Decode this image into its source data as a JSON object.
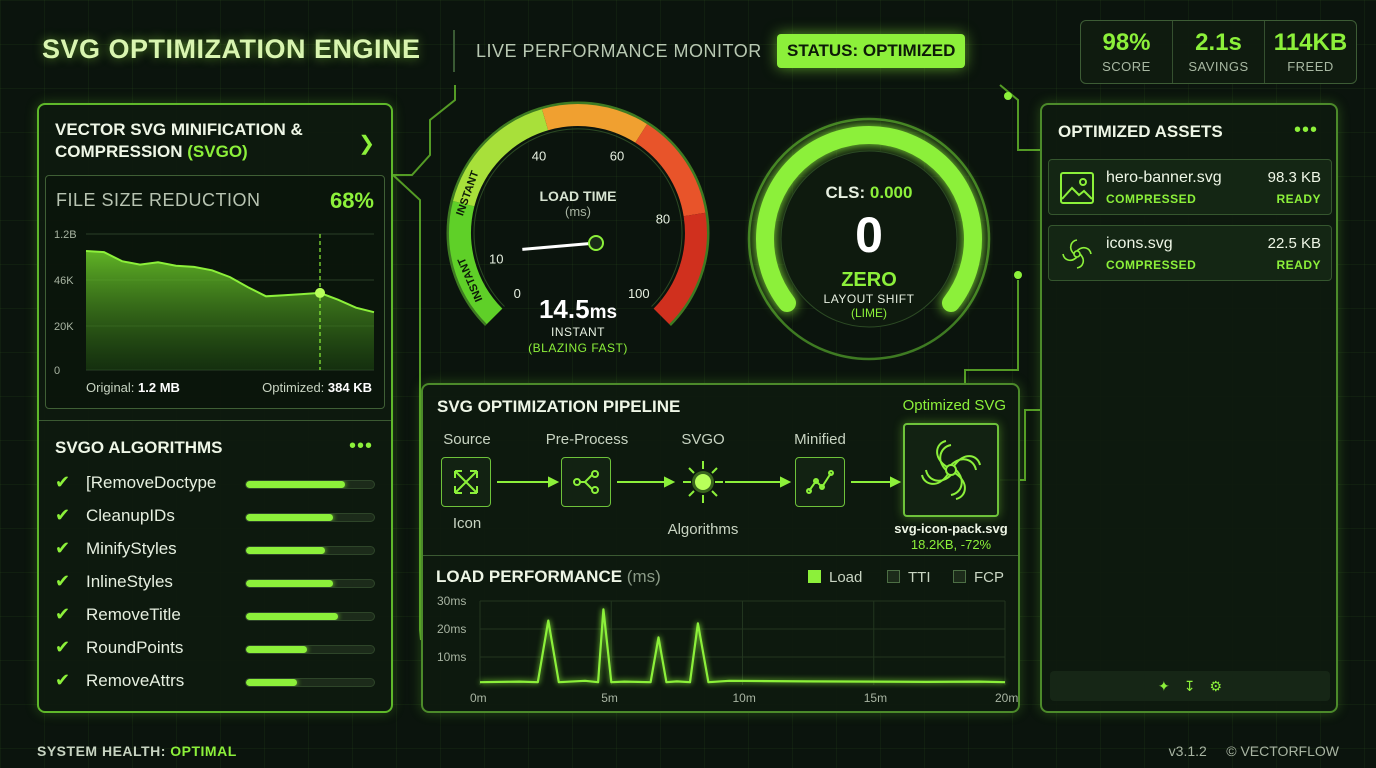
{
  "header": {
    "title": "SVG OPTIMIZATION ENGINE",
    "subtitle": "LIVE PERFORMANCE MONITOR",
    "status": "STATUS: OPTIMIZED",
    "stats": [
      {
        "value": "98%",
        "label": "SCORE"
      },
      {
        "value": "2.1s",
        "label": "SAVINGS"
      },
      {
        "value": "114KB",
        "label": "FREED"
      }
    ]
  },
  "left_panel": {
    "title_line1": "VECTOR SVG MINIFICATION &",
    "title_line2": "COMPRESSION",
    "title_accent": "(SVGO)",
    "file_size_label": "FILE SIZE REDUCTION",
    "file_size_pct": "68%",
    "original_label": "Original:",
    "original_value": "1.2 MB",
    "optimized_label": "Optimized:",
    "optimized_value": "384 KB",
    "algorithms_title": "SVGO ALGORITHMS",
    "algorithms": [
      {
        "name": "[RemoveDoctype",
        "level": 0.77
      },
      {
        "name": "CleanupIDs",
        "level": 0.68
      },
      {
        "name": "MinifyStyles",
        "level": 0.62
      },
      {
        "name": "InlineStyles",
        "level": 0.68
      },
      {
        "name": "RemoveTitle",
        "level": 0.72
      },
      {
        "name": "RoundPoints",
        "level": 0.48
      },
      {
        "name": "RemoveAttrs",
        "level": 0.4
      }
    ]
  },
  "chart_data": [
    {
      "type": "area",
      "title": "FILE SIZE REDUCTION",
      "y_ticks": [
        "1.2B",
        "46K",
        "20K",
        "0"
      ],
      "ylim": [
        0,
        1.2
      ],
      "x": [
        0,
        1,
        2,
        3,
        4,
        5,
        6,
        7,
        8,
        9,
        10,
        11,
        12,
        13,
        14,
        15,
        16
      ],
      "values": [
        1.05,
        1.04,
        0.96,
        0.93,
        0.95,
        0.92,
        0.91,
        0.88,
        0.82,
        0.73,
        0.65,
        0.66,
        0.67,
        0.68,
        0.62,
        0.55,
        0.51
      ],
      "marker_x": 13,
      "grid": true
    },
    {
      "type": "line",
      "title": "LOAD PERFORMANCE",
      "title_unit": "(ms)",
      "series": [
        {
          "name": "Load"
        },
        {
          "name": "TTI"
        },
        {
          "name": "FCP"
        }
      ],
      "y_ticks": [
        "30ms",
        "20ms",
        "10ms"
      ],
      "x_ticks": [
        "0m",
        "5m",
        "10m",
        "15m",
        "20m"
      ],
      "xlim": [
        0,
        20
      ],
      "ylim": [
        0,
        30
      ],
      "x": [
        0,
        1.5,
        2.2,
        2.6,
        3.0,
        4.0,
        4.5,
        4.7,
        5.0,
        5.5,
        6.5,
        6.8,
        7.1,
        7.5,
        8.0,
        8.3,
        8.7,
        9.5,
        12.5,
        15,
        17,
        19,
        20
      ],
      "values": [
        1,
        1.2,
        1,
        23,
        1,
        1.5,
        1,
        27,
        1,
        1.2,
        1,
        17,
        1,
        1.3,
        1,
        22,
        1,
        1.5,
        1.3,
        1.2,
        1.1,
        1.2,
        1
      ]
    }
  ],
  "gauge_load": {
    "title": "LOAD TIME",
    "unit": "(ms)",
    "value_num": "14.5",
    "value_unit": "ms",
    "label": "INSTANT",
    "sublabel": "(BLAZING FAST)",
    "ticks": [
      "0",
      "10",
      "40",
      "60",
      "80",
      "100"
    ],
    "band_label": "INSTANT",
    "needle_value": 14.5
  },
  "gauge_cls": {
    "title": "CLS:",
    "title_value": "0.000",
    "value": "0",
    "label": "ZERO",
    "sublabel1": "LAYOUT SHIFT",
    "sublabel2": "(LIME)"
  },
  "pipeline": {
    "title": "SVG OPTIMIZATION PIPELINE",
    "optimized_label": "Optimized SVG",
    "steps": [
      "Source",
      "Pre-Process",
      "SVGO",
      "Minified"
    ],
    "source_sub": "Icon",
    "svgo_sub": "Algorithms",
    "output_file": "svg-icon-pack.svg",
    "output_stats": "18.2KB,  -72%"
  },
  "load_performance": {
    "title": "LOAD PERFORMANCE",
    "unit": "(ms)",
    "legend": [
      "Load",
      "TTI",
      "FCP"
    ]
  },
  "assets": {
    "title": "OPTIMIZED ASSETS",
    "items": [
      {
        "name": "hero-banner.svg",
        "status": "COMPRESSED",
        "size": "98.3 KB",
        "state": "READY",
        "icon": "image-icon"
      },
      {
        "name": "icons.svg",
        "status": "COMPRESSED",
        "size": "22.5 KB",
        "state": "READY",
        "icon": "spiral-icon"
      }
    ]
  },
  "footer": {
    "health_label": "SYSTEM HEALTH:",
    "health_value": "OPTIMAL",
    "version": "v3.1.2",
    "copyright": "© VECTORFLOW"
  },
  "colors": {
    "accent": "#8cf03a",
    "background": "#0b140d",
    "danger": "#e03a2a",
    "warning": "#f0a030"
  }
}
